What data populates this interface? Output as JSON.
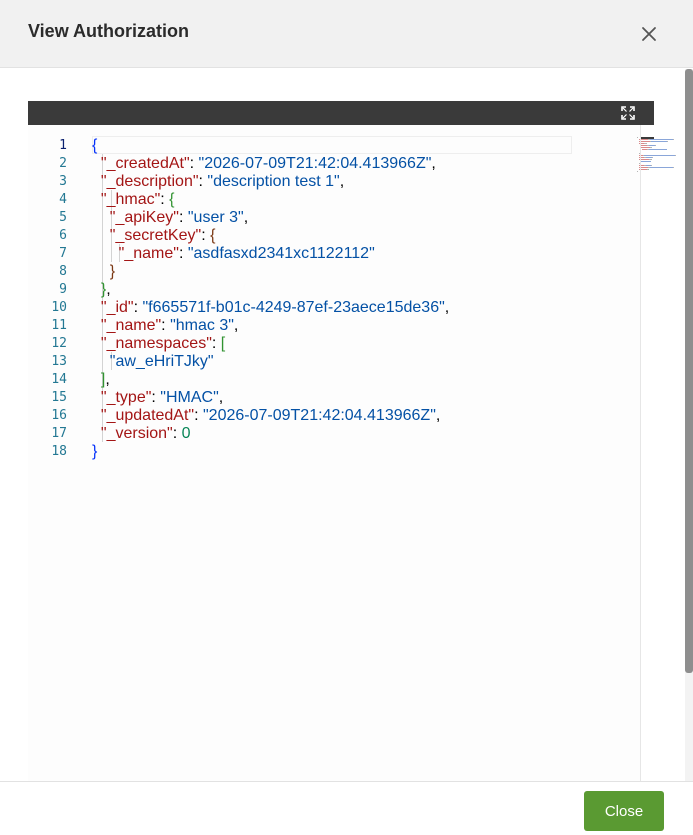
{
  "dialog": {
    "title": "View Authorization",
    "close_icon": "close-icon",
    "close_button_label": "Close"
  },
  "editor": {
    "expand_icon": "expand-icon",
    "line_numbers": [
      "1",
      "2",
      "3",
      "4",
      "5",
      "6",
      "7",
      "8",
      "9",
      "10",
      "11",
      "12",
      "13",
      "14",
      "15",
      "16",
      "17",
      "18"
    ],
    "lines": [
      [
        {
          "t": "{",
          "c": "b1"
        }
      ],
      [
        {
          "t": "  "
        },
        {
          "t": "\"_createdAt\"",
          "c": "k"
        },
        {
          "t": ": "
        },
        {
          "t": "\"2026-07-09T21:42:04.413966Z\"",
          "c": "s"
        },
        {
          "t": ","
        }
      ],
      [
        {
          "t": "  "
        },
        {
          "t": "\"_description\"",
          "c": "k"
        },
        {
          "t": ": "
        },
        {
          "t": "\"description test 1\"",
          "c": "s"
        },
        {
          "t": ","
        }
      ],
      [
        {
          "t": "  "
        },
        {
          "t": "\"_hmac\"",
          "c": "k"
        },
        {
          "t": ": "
        },
        {
          "t": "{",
          "c": "b2"
        }
      ],
      [
        {
          "t": "    "
        },
        {
          "t": "\"_apiKey\"",
          "c": "k"
        },
        {
          "t": ": "
        },
        {
          "t": "\"user 3\"",
          "c": "s"
        },
        {
          "t": ","
        }
      ],
      [
        {
          "t": "    "
        },
        {
          "t": "\"_secretKey\"",
          "c": "k"
        },
        {
          "t": ": "
        },
        {
          "t": "{",
          "c": "b3"
        }
      ],
      [
        {
          "t": "      "
        },
        {
          "t": "\"_name\"",
          "c": "k"
        },
        {
          "t": ": "
        },
        {
          "t": "\"asdfasxd2341xc1122112\"",
          "c": "s"
        }
      ],
      [
        {
          "t": "    "
        },
        {
          "t": "}",
          "c": "b3"
        }
      ],
      [
        {
          "t": "  "
        },
        {
          "t": "}",
          "c": "b2"
        },
        {
          "t": ","
        }
      ],
      [
        {
          "t": "  "
        },
        {
          "t": "\"_id\"",
          "c": "k"
        },
        {
          "t": ": "
        },
        {
          "t": "\"f665571f-b01c-4249-87ef-23aece15de36\"",
          "c": "s"
        },
        {
          "t": ","
        }
      ],
      [
        {
          "t": "  "
        },
        {
          "t": "\"_name\"",
          "c": "k"
        },
        {
          "t": ": "
        },
        {
          "t": "\"hmac 3\"",
          "c": "s"
        },
        {
          "t": ","
        }
      ],
      [
        {
          "t": "  "
        },
        {
          "t": "\"_namespaces\"",
          "c": "k"
        },
        {
          "t": ": "
        },
        {
          "t": "[",
          "c": "b2"
        }
      ],
      [
        {
          "t": "    "
        },
        {
          "t": "\"aw_eHriTJky\"",
          "c": "s"
        }
      ],
      [
        {
          "t": "  "
        },
        {
          "t": "]",
          "c": "b2"
        },
        {
          "t": ","
        }
      ],
      [
        {
          "t": "  "
        },
        {
          "t": "\"_type\"",
          "c": "k"
        },
        {
          "t": ": "
        },
        {
          "t": "\"HMAC\"",
          "c": "s"
        },
        {
          "t": ","
        }
      ],
      [
        {
          "t": "  "
        },
        {
          "t": "\"_updatedAt\"",
          "c": "k"
        },
        {
          "t": ": "
        },
        {
          "t": "\"2026-07-09T21:42:04.413966Z\"",
          "c": "s"
        },
        {
          "t": ","
        }
      ],
      [
        {
          "t": "  "
        },
        {
          "t": "\"_version\"",
          "c": "k"
        },
        {
          "t": ": "
        },
        {
          "t": "0",
          "c": "n"
        }
      ],
      [
        {
          "t": "}",
          "c": "b1"
        }
      ]
    ]
  },
  "colors": {
    "key": "#a31515",
    "string": "#0451a5",
    "number": "#098658",
    "primary_button": "#5a9a32"
  }
}
